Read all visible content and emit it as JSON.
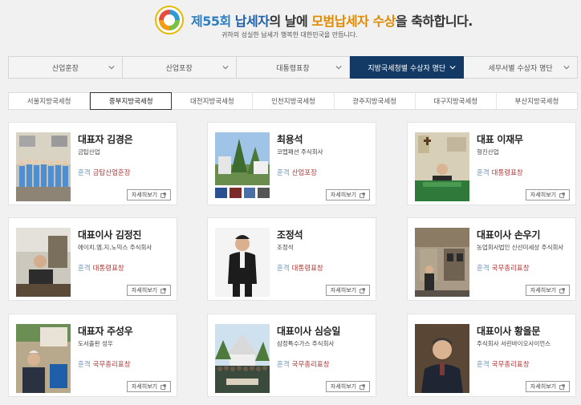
{
  "header": {
    "title_part1": "제55회",
    "title_part2": "납세자",
    "title_part3": "의 날에",
    "title_part4": "모범납세자 수상",
    "title_part5": "을 축하합니다.",
    "subtitle": "귀하의 성실한 납세가 행복한 대한민국을 만듭니다."
  },
  "main_tabs": [
    {
      "label": "산업훈장"
    },
    {
      "label": "산업포장"
    },
    {
      "label": "대통령표창"
    },
    {
      "label": "지방국세청별 수상자 명단",
      "active": true
    },
    {
      "label": "세무서별 수상자 명단"
    }
  ],
  "sub_tabs": [
    {
      "label": "서울지방국세청"
    },
    {
      "label": "중부지방국세청",
      "active": true
    },
    {
      "label": "대전지방국세청"
    },
    {
      "label": "인천지방국세청"
    },
    {
      "label": "광주지방국세청"
    },
    {
      "label": "대구지방국세청"
    },
    {
      "label": "부산지방국세청"
    }
  ],
  "award_label": "훈격",
  "more_label": "자세히보기",
  "cards": [
    {
      "name": "대표자 김경은",
      "company": "금탑산업",
      "award": "금탑산업훈장"
    },
    {
      "name": "최용석",
      "company": "코맵패션 주식회사",
      "award": "산업포장"
    },
    {
      "name": "대표 이재무",
      "company": "형진산업",
      "award": "대통령표창"
    },
    {
      "name": "대표이사 김정진",
      "company": "에이치.엠.지.노믹스 주식회사",
      "award": "대통령표창"
    },
    {
      "name": "조정석",
      "company": "조정석",
      "award": "대통령표창"
    },
    {
      "name": "대표이사 손우기",
      "company": "농업회사법인 신선미세상 주식회사",
      "award": "국무총리표창"
    },
    {
      "name": "대표자 주성우",
      "company": "도서출판 성우",
      "award": "국무총리표창"
    },
    {
      "name": "대표이사 심승일",
      "company": "삼정특수가스 주식회사",
      "award": "국무총리표창"
    },
    {
      "name": "대표이사 황을문",
      "company": "주식회사 서린바이오사이언스",
      "award": "국무총리표창"
    }
  ],
  "colors": {
    "active_tab": "#123a64",
    "award_text": "#b03a3a",
    "title_blue": "#2e7fc1",
    "title_orange": "#e08a00"
  }
}
